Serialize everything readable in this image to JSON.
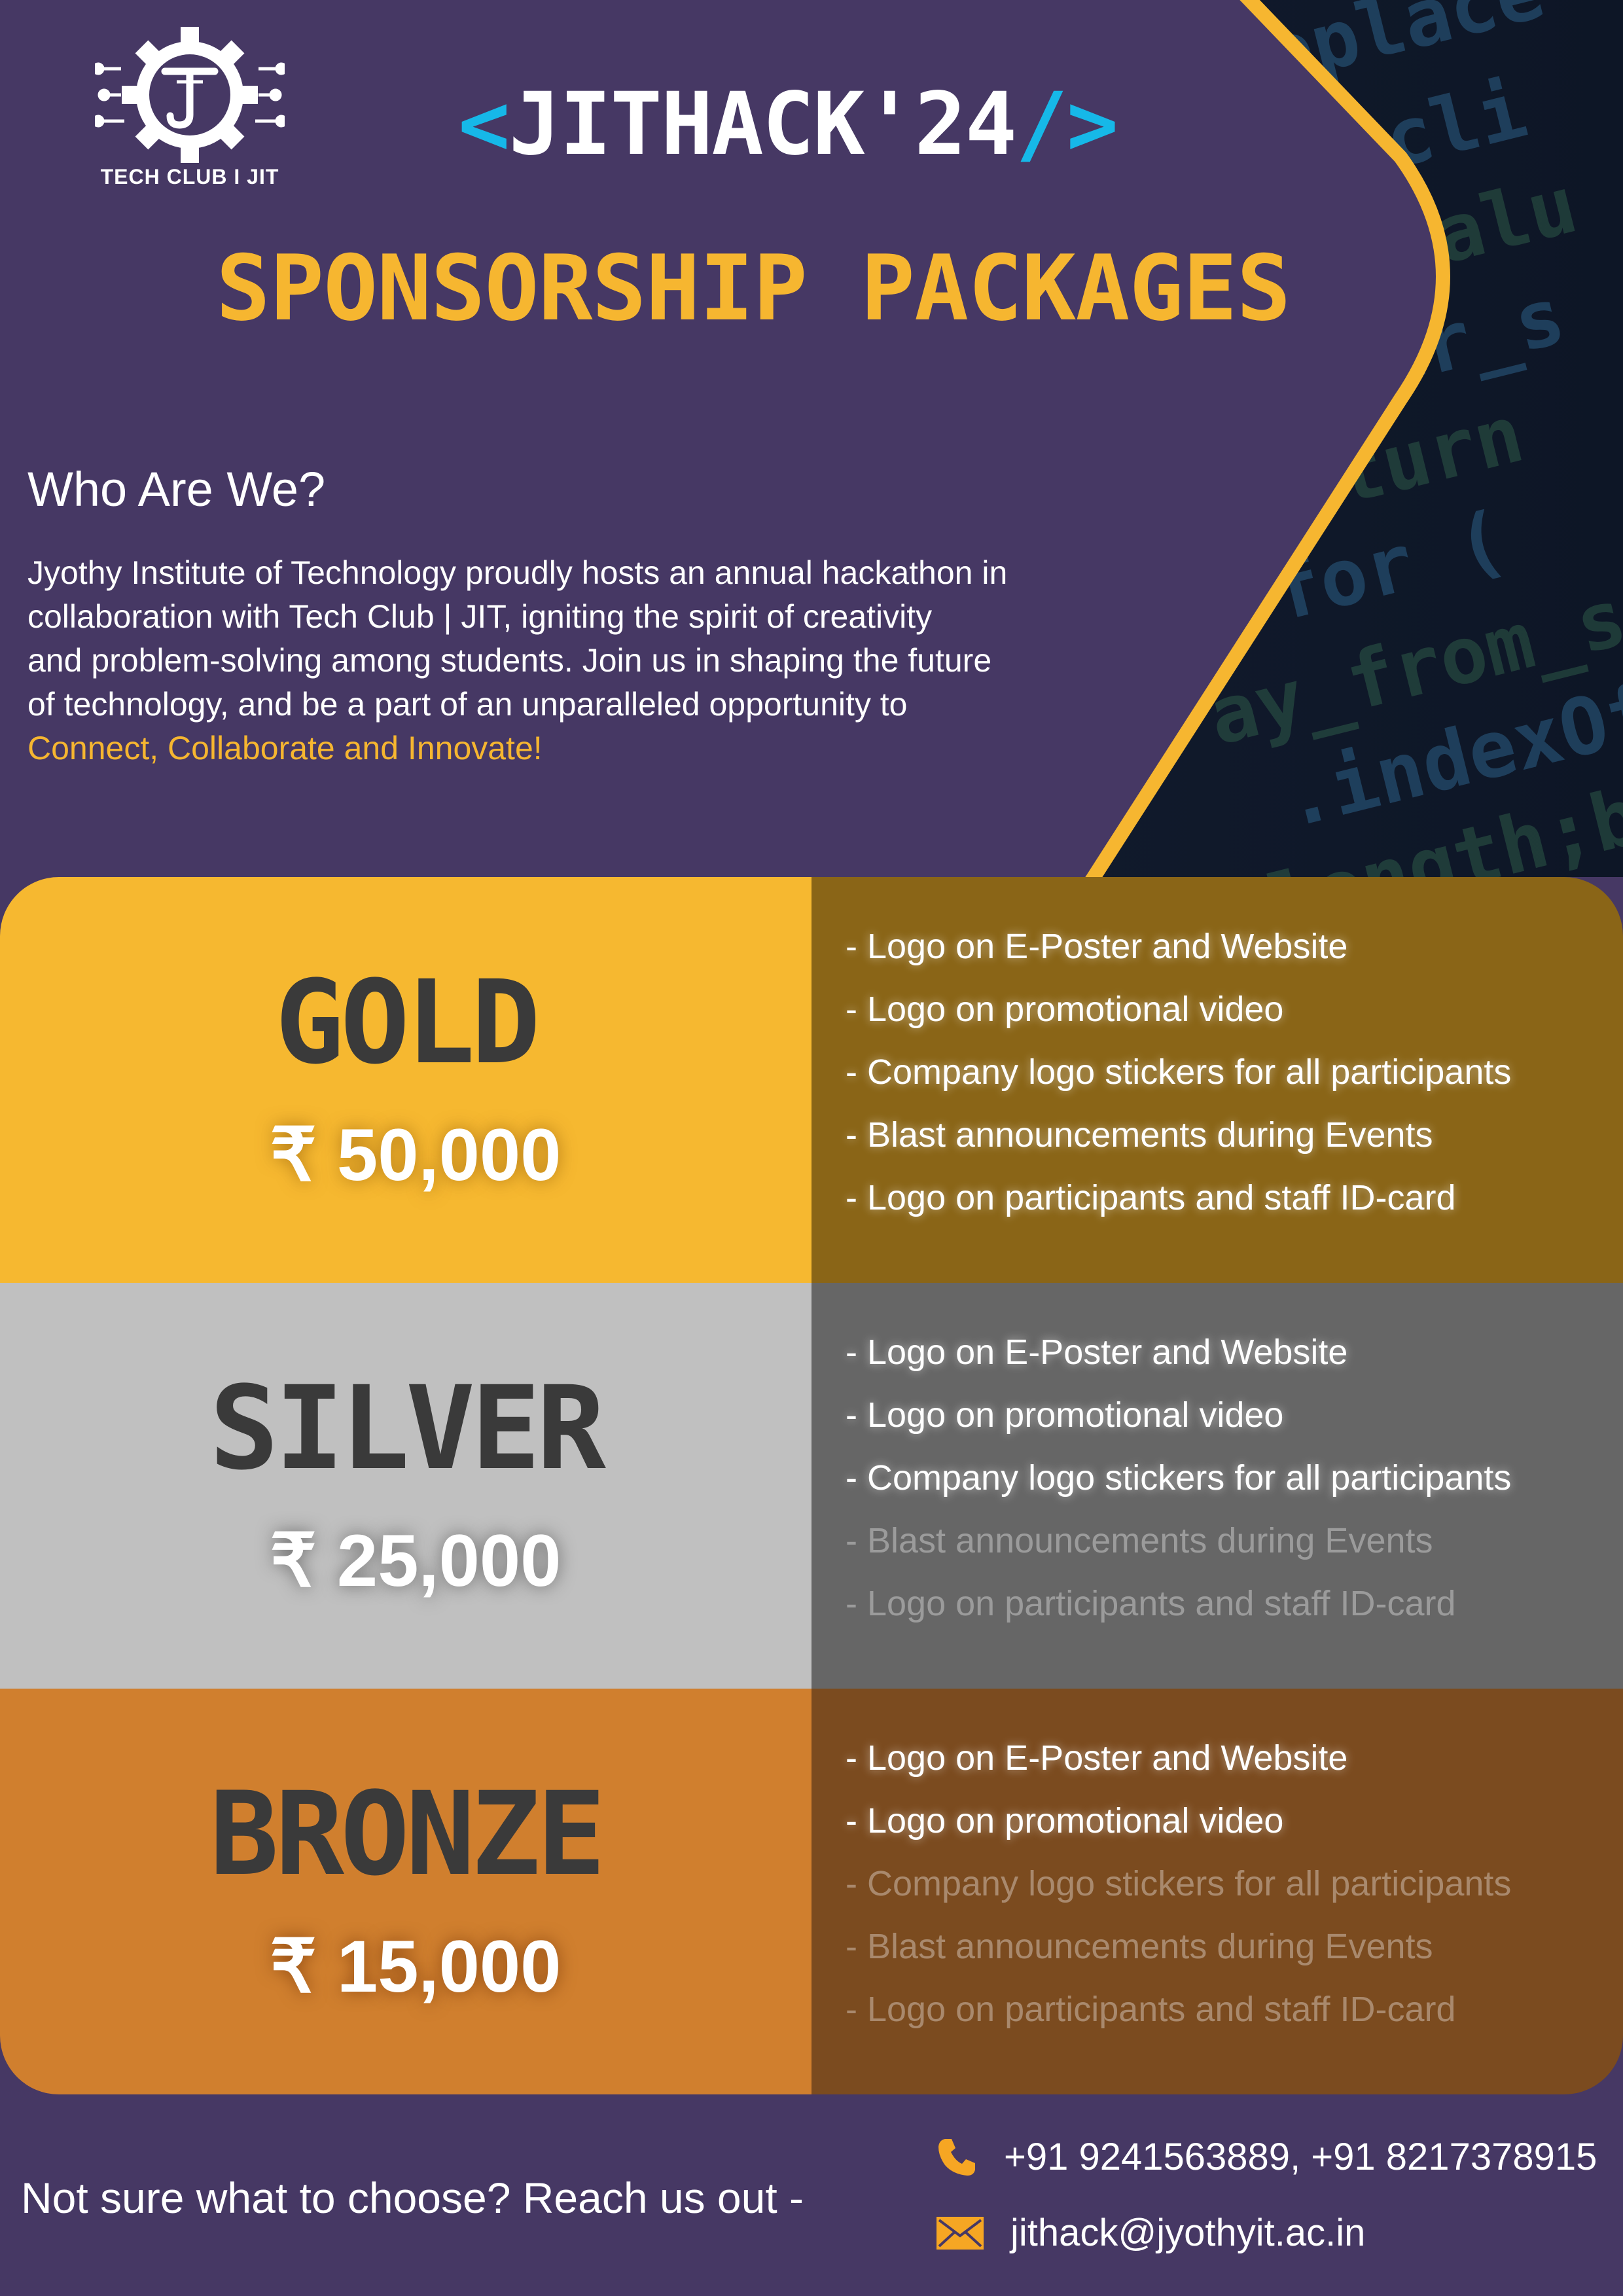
{
  "colors": {
    "background": "#463864",
    "accent_yellow": "#F6B630",
    "accent_cyan": "#16B8E8",
    "gold": "#F6B830",
    "gold_dark": "#8A6517",
    "silver": "#C0C0C0",
    "silver_dark": "#666666",
    "bronze": "#D07F2E",
    "bronze_dark": "#7B4B1F"
  },
  "logo": {
    "icon": "gear-circuit-logo",
    "text": "TECH CLUB I JIT"
  },
  "event": {
    "bracket_open": "<",
    "name": "JITHACK'24",
    "bracket_close": "/>"
  },
  "title": "SPONSORSHIP PACKAGES",
  "about": {
    "heading": "Who Are We?",
    "lines": [
      "Jyothy Institute of Technology proudly hosts an annual hackathon in",
      "collaboration with Tech Club | JIT, igniting the spirit of creativity",
      "and problem-solving among students. Join us in shaping the future",
      "of technology, and be a part of an unparalleled opportunity to"
    ],
    "highlight": "Connect, Collaborate and Innovate!"
  },
  "tiers": [
    {
      "name": "GOLD",
      "price": "₹ 50,000",
      "benefits": [
        {
          "text": "- Logo on E-Poster and Website",
          "included": true
        },
        {
          "text": "- Logo on promotional video",
          "included": true
        },
        {
          "text": "- Company logo stickers for all participants",
          "included": true
        },
        {
          "text": "- Blast announcements during Events",
          "included": true
        },
        {
          "text": "- Logo on participants and staff ID-card",
          "included": true
        }
      ]
    },
    {
      "name": "SILVER",
      "price": "₹ 25,000",
      "benefits": [
        {
          "text": "- Logo on E-Poster and Website",
          "included": true
        },
        {
          "text": "- Logo on promotional video",
          "included": true
        },
        {
          "text": "- Company logo stickers for all participants",
          "included": true
        },
        {
          "text": "- Blast announcements during Events",
          "included": false
        },
        {
          "text": "- Logo on participants and staff ID-card",
          "included": false
        }
      ]
    },
    {
      "name": "BRONZE",
      "price": "₹ 15,000",
      "benefits": [
        {
          "text": "- Logo on E-Poster and Website",
          "included": true
        },
        {
          "text": "- Logo on promotional video",
          "included": true
        },
        {
          "text": "- Company logo stickers for all participants",
          "included": false
        },
        {
          "text": "- Blast announcements during Events",
          "included": false
        },
        {
          "text": "- Logo on participants and staff ID-card",
          "included": false
        }
      ]
    }
  ],
  "footer": {
    "prompt": "Not sure what to choose? Reach us out -",
    "phone_icon": "phone-icon",
    "phone": "+91 9241563889, +91 8217378915",
    "email_icon": "envelope-icon",
    "email": "jithack@jyothyit.ac.in"
  }
}
